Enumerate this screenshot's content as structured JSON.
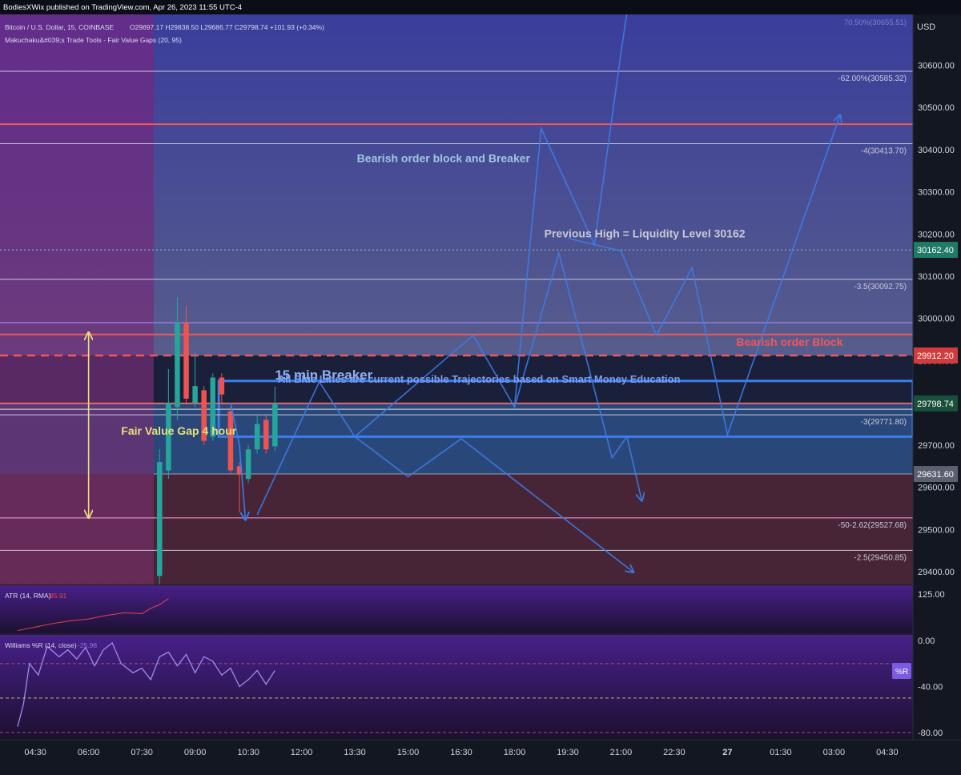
{
  "header": {
    "published": "BodiesXWix published on TradingView.com, Apr 26, 2023 11:55 UTC-4"
  },
  "legend": {
    "symbol": "Bitcoin / U.S. Dollar, 15, COINBASE",
    "ohlc": "O29697.17  H29838.50  L29686.77  C29798.74  +101.93 (+0.34%)",
    "indicator": "Makuchaku&#039;s Trade Tools - Fair Value Gaps (20, 95)"
  },
  "colors": {
    "background": "#131722",
    "up_candle": "#26a69a",
    "down_candle": "#ef5350",
    "trajectory": "#3d7de8",
    "resistance": "#f0585a",
    "fvg_arrow": "#e6e07a",
    "atr_line": "#e04848",
    "williams_line": "#9b8cf0"
  },
  "chart_data": [
    {
      "type": "candlestick",
      "title": "Bitcoin / U.S. Dollar, 15, COINBASE",
      "currency": "USD",
      "ylim": [
        29370,
        30720
      ],
      "y_ticks": [
        29400,
        29500,
        29600,
        29700,
        29800,
        29900,
        30000,
        30100,
        30200,
        30300,
        30400,
        30500,
        30600
      ],
      "y_tick_labels": [
        "29400.00",
        "29500.00",
        "29600.00",
        "29700.00",
        "29800.00",
        "29900.00",
        "30000.00",
        "30100.00",
        "30200.00",
        "30300.00",
        "30400.00",
        "30500.00",
        "30600.00"
      ],
      "x_axis": {
        "start": "2023-04-26 04:00",
        "end": "2023-04-27 05:00",
        "tick_times": [
          "2023-04-26 04:30",
          "2023-04-26 06:00",
          "2023-04-26 07:30",
          "2023-04-26 09:00",
          "2023-04-26 10:30",
          "2023-04-26 12:00",
          "2023-04-26 13:30",
          "2023-04-26 15:00",
          "2023-04-26 16:30",
          "2023-04-26 18:00",
          "2023-04-26 19:30",
          "2023-04-26 21:00",
          "2023-04-26 22:30",
          "2023-04-27 00:00",
          "2023-04-27 01:30",
          "2023-04-27 03:00",
          "2023-04-27 04:30"
        ],
        "tick_labels": [
          "04:30",
          "06:00",
          "07:30",
          "09:00",
          "10:30",
          "12:00",
          "13:30",
          "15:00",
          "16:30",
          "18:00",
          "19:30",
          "21:00",
          "22:30",
          "27",
          "01:30",
          "03:00",
          "04:30"
        ]
      },
      "candles": [
        {
          "t": "2023-04-26 08:00",
          "o": 29390,
          "h": 29690,
          "l": 29370,
          "c": 29660
        },
        {
          "t": "2023-04-26 08:15",
          "o": 29640,
          "h": 29880,
          "l": 29620,
          "c": 29800
        },
        {
          "t": "2023-04-26 08:30",
          "o": 29790,
          "h": 30050,
          "l": 29760,
          "c": 29990
        },
        {
          "t": "2023-04-26 08:45",
          "o": 29990,
          "h": 30030,
          "l": 29800,
          "c": 29810
        },
        {
          "t": "2023-04-26 09:00",
          "o": 29800,
          "h": 29920,
          "l": 29790,
          "c": 29840
        },
        {
          "t": "2023-04-26 09:15",
          "o": 29830,
          "h": 29840,
          "l": 29700,
          "c": 29710
        },
        {
          "t": "2023-04-26 09:30",
          "o": 29720,
          "h": 29870,
          "l": 29710,
          "c": 29860
        },
        {
          "t": "2023-04-26 09:45",
          "o": 29860,
          "h": 29870,
          "l": 29800,
          "c": 29820
        },
        {
          "t": "2023-04-26 10:00",
          "o": 29780,
          "h": 29790,
          "l": 29630,
          "c": 29640
        },
        {
          "t": "2023-04-26 10:15",
          "o": 29650,
          "h": 29660,
          "l": 29540,
          "c": 29630
        },
        {
          "t": "2023-04-26 10:30",
          "o": 29620,
          "h": 29700,
          "l": 29610,
          "c": 29690
        },
        {
          "t": "2023-04-26 10:45",
          "o": 29690,
          "h": 29770,
          "l": 29680,
          "c": 29750
        },
        {
          "t": "2023-04-26 11:00",
          "o": 29760,
          "h": 29770,
          "l": 29680,
          "c": 29690
        },
        {
          "t": "2023-04-26 11:15",
          "o": 29697.17,
          "h": 29838.5,
          "l": 29686.77,
          "c": 29798.74
        }
      ],
      "zones": [
        {
          "name": "bearish-zone",
          "from": 29912.2,
          "to": 30720,
          "color": "#5560a8"
        },
        {
          "name": "fvg-zone",
          "from": 29631.6,
          "to": 29798.74,
          "color": "#2b4a7c"
        },
        {
          "name": "discount-zone",
          "from": 29370,
          "to": 29631.6,
          "color": "#4a2636"
        }
      ],
      "breaker_box": {
        "from": 29720,
        "to": 29852
      },
      "levels": [
        {
          "name": "fib-62-level",
          "price": 30585.32,
          "label": "-62.00%(30585.32)",
          "color": "#c8c8d8"
        },
        {
          "name": "red-level-upper",
          "price": 30460,
          "label": "",
          "color": "#f0585a"
        },
        {
          "name": "fib-4-level",
          "price": 30413.7,
          "label": "-4(30413.70)",
          "color": "#c8c8d8"
        },
        {
          "name": "liquidity-level",
          "price": 30162.4,
          "label": "",
          "color": "#7fd3c0"
        },
        {
          "name": "fib-3-5-level",
          "price": 30092.75,
          "label": "-3.5(30092.75)",
          "color": "#c8c8d8"
        },
        {
          "name": "lavender-level",
          "price": 29990,
          "label": "",
          "color": "#b58cff"
        },
        {
          "name": "red-level-mid",
          "price": 29962,
          "label": "",
          "color": "#f0585a"
        },
        {
          "name": "fib-3-level",
          "price": 29771.8,
          "label": "-3(29771.80)",
          "color": "#c8c8d8"
        },
        {
          "name": "fib-2-62-level",
          "price": 29527.68,
          "label": "-50-2.62(29527.68)",
          "color": "#ff9ee0"
        },
        {
          "name": "fib-2-5-level",
          "price": 29450.85,
          "label": "-2.5(29450.85)",
          "color": "#c8c8d8"
        }
      ],
      "fib_top_label": "70.50%(30655.51)",
      "bearish_ob_level": 29912.2,
      "current_price_line": 29798.74,
      "white_line_lower": 29785,
      "price_badges": [
        {
          "price": 30162.4,
          "label": "30162.40",
          "color": "#1f7a66"
        },
        {
          "price": 29912.2,
          "label": "29912.20",
          "color": "#d23b3b"
        },
        {
          "price": 29798.74,
          "label": "29798.74",
          "color": "#18503a"
        },
        {
          "price": 29631.6,
          "label": "29631.60",
          "color": "#5a6070"
        }
      ],
      "annotations": [
        {
          "name": "annotation-bearish-ob-breaker",
          "text": "Bearish order block and Breaker",
          "t": "2023-04-26 16:00",
          "price": 30370,
          "color": "#9cc8e0"
        },
        {
          "name": "annotation-previous-high",
          "text": "Previous High = Liquidity Level 30162",
          "t": "2023-04-27 00:30",
          "price": 30192,
          "color": "#c8c8d8"
        },
        {
          "name": "annotation-bearish-order-block",
          "text": "Bearish order Block",
          "t": "2023-04-27 03:15",
          "price": 29935,
          "color": "#f0585a"
        },
        {
          "name": "annotation-15min-breaker",
          "text": "15 min Breaker",
          "t": "2023-04-26 11:15",
          "price": 29855,
          "color": "#8fb0f0"
        },
        {
          "name": "annotation-blue-lines",
          "text": "All Blue Lines are current possible Trajectories based on Smart Money Education",
          "t": "2023-04-26 17:00",
          "price": 29848,
          "color": "#7a9cf0"
        },
        {
          "name": "annotation-fair-value-gap",
          "text": "Fair Value Gap 4 hour",
          "t": "2023-04-26 06:55",
          "price": 29725,
          "color": "#e6e07a"
        }
      ],
      "fvg_arrow": {
        "t": "2023-04-26 06:00",
        "from": 29530,
        "to": 29965
      },
      "trajectories": [
        [
          [
            "2023-04-26 10:45",
            29535
          ],
          [
            "2023-04-26 12:30",
            29850
          ],
          [
            "2023-04-26 13:30",
            29720
          ],
          [
            "2023-04-26 16:50",
            29960
          ],
          [
            "2023-04-26 18:00",
            29790
          ],
          [
            "2023-04-26 18:45",
            30450
          ],
          [
            "2023-04-26 20:15",
            30175
          ],
          [
            "2023-04-26 21:00",
            30630
          ],
          [
            "2023-04-26 21:50",
            31100
          ]
        ],
        [
          [
            "2023-04-26 13:30",
            29720
          ],
          [
            "2023-04-26 15:00",
            29625
          ],
          [
            "2023-04-26 16:30",
            29715
          ],
          [
            "2023-04-26 21:20",
            29400
          ]
        ],
        [
          [
            "2023-04-26 18:00",
            29790
          ],
          [
            "2023-04-26 19:15",
            30155
          ],
          [
            "2023-04-26 20:45",
            29670
          ],
          [
            "2023-04-26 21:10",
            29720
          ],
          [
            "2023-04-26 21:35",
            29570
          ]
        ],
        [
          [
            "2023-04-26 19:30",
            30190
          ],
          [
            "2023-04-26 21:00",
            30160
          ],
          [
            "2023-04-26 22:00",
            29960
          ],
          [
            "2023-04-26 23:00",
            30120
          ],
          [
            "2023-04-27 00:00",
            29725
          ],
          [
            "2023-04-27 03:10",
            30480
          ]
        ]
      ],
      "trajectory_wiggle": [
        [
          "2023-04-26 10:00",
          29800
        ],
        [
          "2023-04-26 10:15",
          29700
        ],
        [
          "2023-04-26 10:25",
          29525
        ]
      ]
    },
    {
      "type": "line",
      "title": "ATR (14, RMA)",
      "value_label": "95.91",
      "ylim": [
        80,
        135
      ],
      "y_ticks": [
        125
      ],
      "y_tick_labels": [
        "125.00"
      ],
      "x": [
        "2023-04-26 04:00",
        "2023-04-26 04:30",
        "2023-04-26 05:00",
        "2023-04-26 05:30",
        "2023-04-26 06:00",
        "2023-04-26 06:30",
        "2023-04-26 07:00",
        "2023-04-26 07:30",
        "2023-04-26 07:45",
        "2023-04-26 08:00",
        "2023-04-26 08:15"
      ],
      "values": [
        84,
        88,
        92,
        95,
        97,
        101,
        104,
        103,
        109,
        113,
        120
      ]
    },
    {
      "type": "line",
      "title": "Williams %R (14, close)",
      "value_label": "-25.98",
      "badge": "%R",
      "ylim": [
        -85,
        5
      ],
      "y_ticks": [
        0,
        -40,
        -80
      ],
      "y_tick_labels": [
        "0.00",
        "-40.00",
        "-80.00"
      ],
      "dashed_levels": [
        -20,
        -50,
        -80
      ],
      "x": [
        "2023-04-26 04:00",
        "2023-04-26 04:10",
        "2023-04-26 04:20",
        "2023-04-26 04:35",
        "2023-04-26 04:50",
        "2023-04-26 05:10",
        "2023-04-26 05:25",
        "2023-04-26 05:40",
        "2023-04-26 05:55",
        "2023-04-26 06:10",
        "2023-04-26 06:25",
        "2023-04-26 06:40",
        "2023-04-26 06:55",
        "2023-04-26 07:15",
        "2023-04-26 07:30",
        "2023-04-26 07:45",
        "2023-04-26 08:00",
        "2023-04-26 08:15",
        "2023-04-26 08:30",
        "2023-04-26 08:45",
        "2023-04-26 09:00",
        "2023-04-26 09:15",
        "2023-04-26 09:30",
        "2023-04-26 09:45",
        "2023-04-26 10:00",
        "2023-04-26 10:15",
        "2023-04-26 10:30",
        "2023-04-26 10:45",
        "2023-04-26 11:00",
        "2023-04-26 11:15"
      ],
      "values": [
        -75,
        -55,
        -20,
        -30,
        -5,
        -14,
        -8,
        -16,
        -6,
        -22,
        -8,
        -2,
        -20,
        -28,
        -24,
        -34,
        -14,
        -10,
        -22,
        -12,
        -28,
        -14,
        -18,
        -30,
        -24,
        -40,
        -34,
        -26,
        -38,
        -26
      ]
    }
  ]
}
